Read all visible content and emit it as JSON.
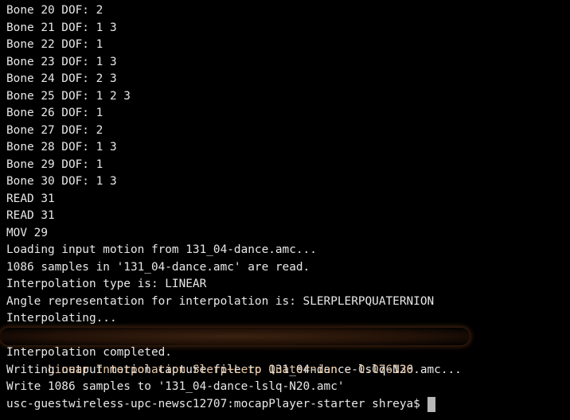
{
  "terminal": {
    "lines": [
      "Bone 20 DOF: 2",
      "Bone 21 DOF: 1 3",
      "Bone 22 DOF: 1",
      "Bone 23 DOF: 1 3",
      "Bone 24 DOF: 2 3",
      "Bone 25 DOF: 1 2 3",
      "Bone 26 DOF: 1",
      "Bone 27 DOF: 2",
      "Bone 28 DOF: 1 3",
      "Bone 29 DOF: 1",
      "Bone 30 DOF: 1 3",
      "READ 31",
      "READ 31",
      "MOV 29",
      "Loading input motion from 131_04-dance.amc...",
      "1086 samples in '131_04-dance.amc' are read.",
      "Interpolation type is: LINEAR",
      "Angle representation for interpolation is: SLERPLERPQUATERNION",
      "Interpolating...",
      "Linear Interpolation Slerp+Lerp Quaternion - 0.076136",
      "Interpolation completed.",
      "Writing output motion capture file to 131_04-dance-lslq-N20.amc...",
      "Write 1086 samples to '131_04-dance-lslq-N20.amc'"
    ],
    "prompt": "usc-guestwireless-upc-newsc12707:mocapPlayer-starter shreya$",
    "colors": {
      "background": "#000000",
      "text": "#e8e8e8",
      "highlight_text": "#e9c9a8",
      "highlight_glow": "#b0602a",
      "cursor": "#b8b8b8"
    }
  }
}
